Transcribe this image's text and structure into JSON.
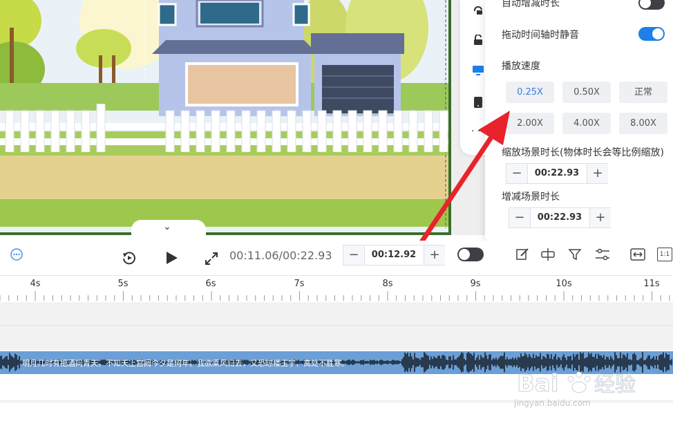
{
  "panel": {
    "auto_label": "自动增减时长",
    "auto_on": false,
    "mute_label": "拖动时间轴时静音",
    "mute_on": true,
    "speed_title": "播放速度",
    "speeds": [
      "0.25X",
      "0.50X",
      "正常",
      "2.00X",
      "4.00X",
      "8.00X"
    ],
    "selected_speed": "0.25X",
    "scale_label": "缩放场景时长(物体时长会等比例缩放)",
    "scale_value": "00:22.93",
    "adjust_label": "增减场景时长",
    "adjust_value": "00:22.93",
    "minus": "−",
    "plus": "+",
    "accent_color": "#1e7fe8"
  },
  "toolbar": {
    "time_display": "00:11.06/00:22.93",
    "duration_value": "00:12.92",
    "minus": "−",
    "plus": "+",
    "ratio_label": "1:1"
  },
  "ruler": {
    "ticks": [
      "4s",
      "5s",
      "6s",
      "7s",
      "8s",
      "9s",
      "10s",
      "11s"
    ]
  },
  "audio_track": {
    "lyrics": "明月几时有把酒问青天，不知天上宫阙今夕是何年。我欲乘风归去，又恐琼楼玉宇，高处不胜寒。",
    "color": "#6b9fd6"
  },
  "watermark": {
    "text": "Bai 经验",
    "sub": "jingyan.baidu.com"
  },
  "icons": [
    "rotate-icon",
    "unlock-icon",
    "monitor-icon",
    "phone-icon",
    "more-icon",
    "more-circle-icon",
    "replay-icon",
    "play-icon",
    "fullscreen-icon",
    "edit-icon",
    "split-icon",
    "filter-icon",
    "settings-sliders-icon",
    "fit-width-icon",
    "ratio-icon",
    "chevron-down-icon"
  ]
}
